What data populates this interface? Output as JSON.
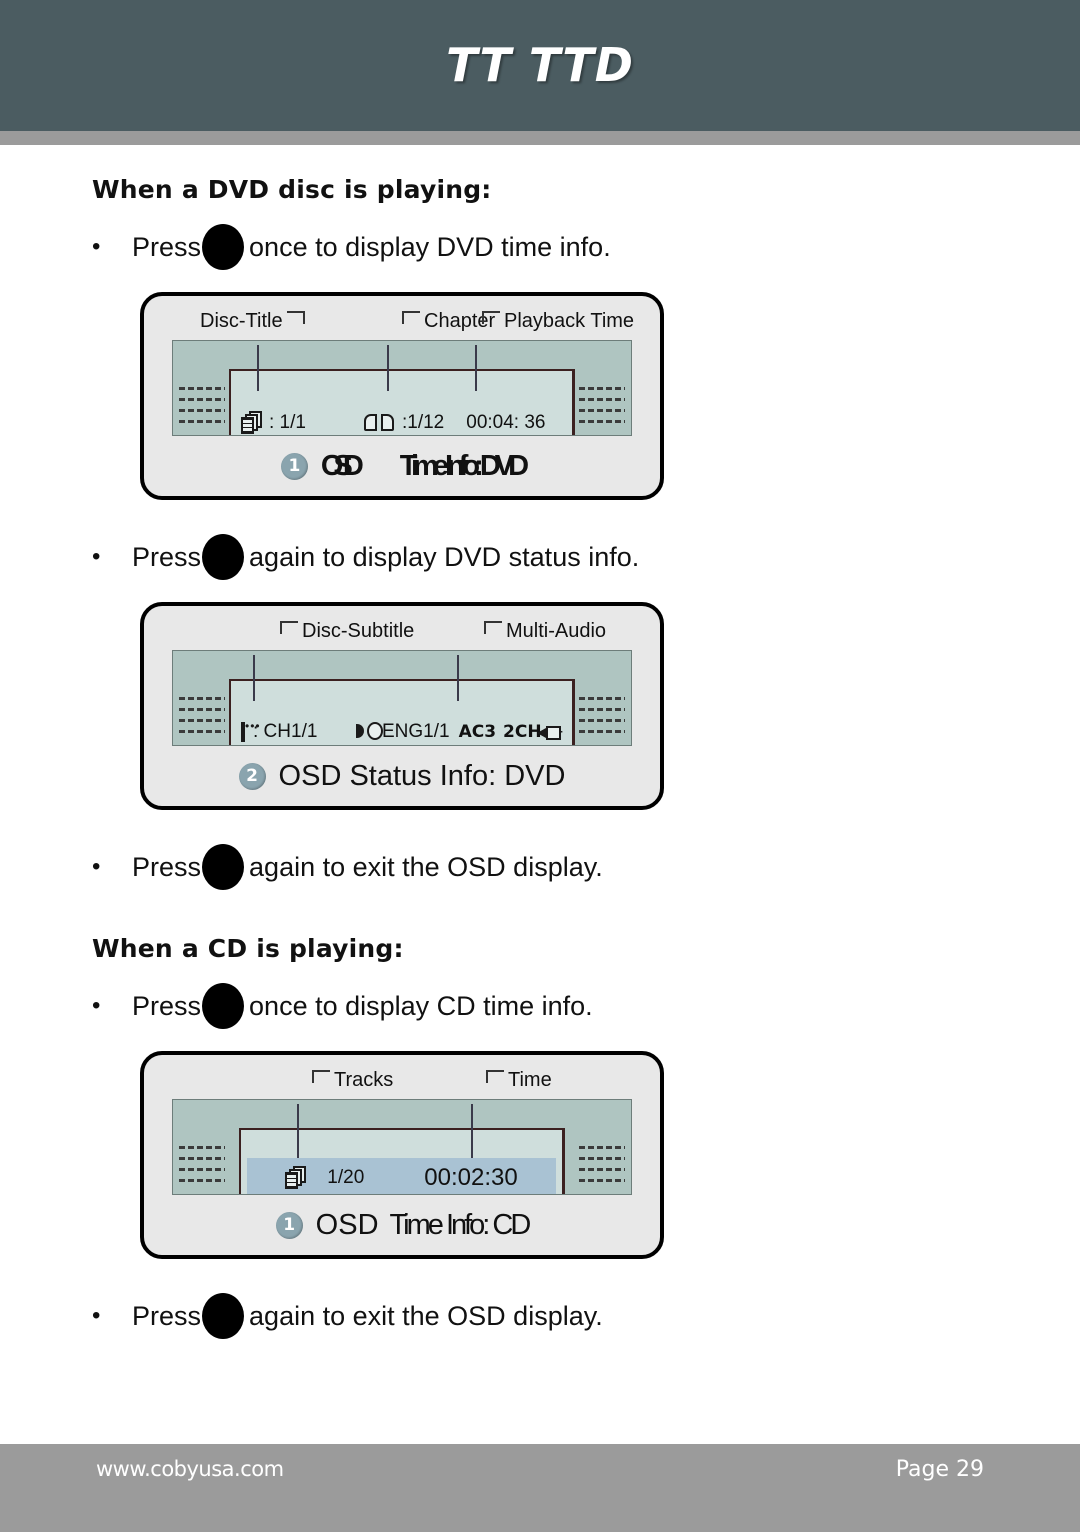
{
  "header": {
    "title": "TT TTD"
  },
  "footer": {
    "url": "www.cobyusa.com",
    "page": "Page 29"
  },
  "sections": [
    {
      "heading": "When a DVD disc is playing:",
      "bullets": [
        {
          "before": "Press ",
          "icon": "osd-button-icon",
          "after": " once to display DVD time info."
        }
      ]
    },
    {
      "heading": "When a CD is playing:",
      "bullets": [
        {
          "before": "Press ",
          "icon": "osd-button-icon",
          "after": " once to display CD time info."
        }
      ]
    }
  ],
  "bullets": {
    "dvd_once_before": "Press",
    "dvd_once_after": "once to display DVD time info.",
    "dvd_again_before": "Press",
    "dvd_again_after": "again to display DVD status info.",
    "dvd_exit_before": "Press",
    "dvd_exit_after": "again to exit the OSD display.",
    "cd_once_before": "Press",
    "cd_once_after": "once to display CD time info.",
    "cd_exit_before": "Press",
    "cd_exit_after": "again to exit the OSD display.",
    "marker": "•"
  },
  "headings": {
    "dvd": "When a DVD disc is playing:",
    "cd": "When a CD is playing:"
  },
  "diagram_dvd_time": {
    "callouts": {
      "disc_title": "Disc-Title",
      "chapter": "Chapter",
      "playback_time": "Playback  Time"
    },
    "fields": {
      "title_value": ": 1/1",
      "chapter_value": ":1/12",
      "time_value": "00:04: 36"
    },
    "badge": "1",
    "caption_raw": "OSD Time Info: DVD",
    "caption_glitch_1": "OSD",
    "caption_glitch_2": "Time Info: DVD"
  },
  "diagram_dvd_status": {
    "callouts": {
      "disc_subtitle": "Disc-Subtitle",
      "multi_audio": "Multi-Audio"
    },
    "fields": {
      "subtitle_value": ": CH1/1",
      "audio_value": ": ENG1/1",
      "codec": "AC3",
      "channels": "2CH",
      "trailing_dashes": "--"
    },
    "badge": "2",
    "caption": "OSD Status Info: DVD"
  },
  "diagram_cd_time": {
    "callouts": {
      "tracks": "Tracks",
      "time": "Time"
    },
    "fields": {
      "tracks_value": "1/20",
      "time_value": "00:02:30"
    },
    "badge": "1",
    "caption_prefix": "OSD",
    "caption_glitch": "Time Info: CD"
  },
  "colors": {
    "header_bg": "#4b5c61",
    "rule_gray": "#9b9b9b",
    "box_fill": "#e8e8e8",
    "screen_teal": "#afc5c1",
    "screen_inner": "#cfdedc",
    "cd_band_blue": "#a9c2d3",
    "badge_blue": "#8aa4ae",
    "text": "#111111"
  }
}
